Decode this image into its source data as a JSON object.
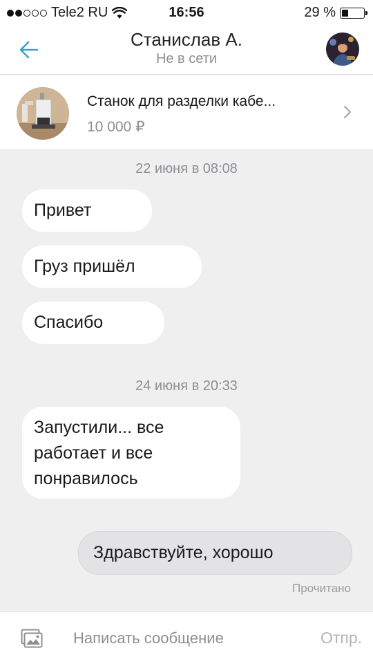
{
  "status_bar": {
    "carrier": "Tele2 RU",
    "signal_bars": 2,
    "signal_total": 5,
    "time": "16:56",
    "battery_percent": "29 %",
    "battery_level": 0.29
  },
  "header": {
    "contact_name": "Станислав А.",
    "presence": "Не в сети",
    "back_icon": "arrow-left-icon",
    "avatar_icon": "user-avatar-photo"
  },
  "listing": {
    "title": "Станок для разделки кабе...",
    "price": "10 000 ₽",
    "chevron_icon": "chevron-right-icon"
  },
  "chat": {
    "date_1": "22 июня в 08:08",
    "date_2": "24 июня в 20:33",
    "messages": [
      {
        "direction": "incoming",
        "text": "Привет"
      },
      {
        "direction": "incoming",
        "text": "Груз пришёл"
      },
      {
        "direction": "incoming",
        "text": "Спасибо"
      },
      {
        "direction": "incoming",
        "lines": [
          "Запустили... все",
          "работает и все",
          "понравилось"
        ]
      },
      {
        "direction": "outgoing",
        "text": "Здравствуйте, хорошо"
      }
    ],
    "read_status": "Прочитано"
  },
  "composer": {
    "placeholder": "Написать сообщение",
    "send_label": "Отпр.",
    "attach_icon": "image-attach-icon"
  },
  "colors": {
    "accent": "#3aa3c9",
    "background": "#efeff0",
    "bubble_incoming": "#ffffff",
    "bubble_outgoing": "#e3e3e5",
    "muted_text": "#8e8e93"
  }
}
